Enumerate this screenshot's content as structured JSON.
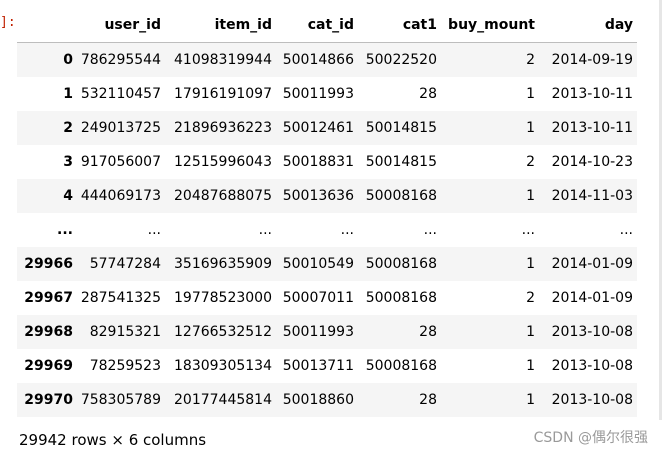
{
  "prompt_fragment": "]:",
  "table": {
    "columns": [
      "",
      "user_id",
      "item_id",
      "cat_id",
      "cat1",
      "buy_mount",
      "day"
    ],
    "rows": [
      {
        "index": "0",
        "cells": [
          "786295544",
          "41098319944",
          "50014866",
          "50022520",
          "2",
          "2014-09-19"
        ]
      },
      {
        "index": "1",
        "cells": [
          "532110457",
          "17916191097",
          "50011993",
          "28",
          "1",
          "2013-10-11"
        ]
      },
      {
        "index": "2",
        "cells": [
          "249013725",
          "21896936223",
          "50012461",
          "50014815",
          "1",
          "2013-10-11"
        ]
      },
      {
        "index": "3",
        "cells": [
          "917056007",
          "12515996043",
          "50018831",
          "50014815",
          "2",
          "2014-10-23"
        ]
      },
      {
        "index": "4",
        "cells": [
          "444069173",
          "20487688075",
          "50013636",
          "50008168",
          "1",
          "2014-11-03"
        ]
      },
      {
        "index": "...",
        "cells": [
          "...",
          "...",
          "...",
          "...",
          "...",
          "..."
        ]
      },
      {
        "index": "29966",
        "cells": [
          "57747284",
          "35169635909",
          "50010549",
          "50008168",
          "1",
          "2014-01-09"
        ]
      },
      {
        "index": "29967",
        "cells": [
          "287541325",
          "19778523000",
          "50007011",
          "50008168",
          "2",
          "2014-01-09"
        ]
      },
      {
        "index": "29968",
        "cells": [
          "82915321",
          "12766532512",
          "50011993",
          "28",
          "1",
          "2013-10-08"
        ]
      },
      {
        "index": "29969",
        "cells": [
          "78259523",
          "18309305134",
          "50013711",
          "50008168",
          "1",
          "2013-10-08"
        ]
      },
      {
        "index": "29970",
        "cells": [
          "758305789",
          "20177445814",
          "50018860",
          "28",
          "1",
          "2013-10-08"
        ]
      }
    ]
  },
  "summary": "29942 rows × 6 columns",
  "watermark": "CSDN @偶尔很强"
}
